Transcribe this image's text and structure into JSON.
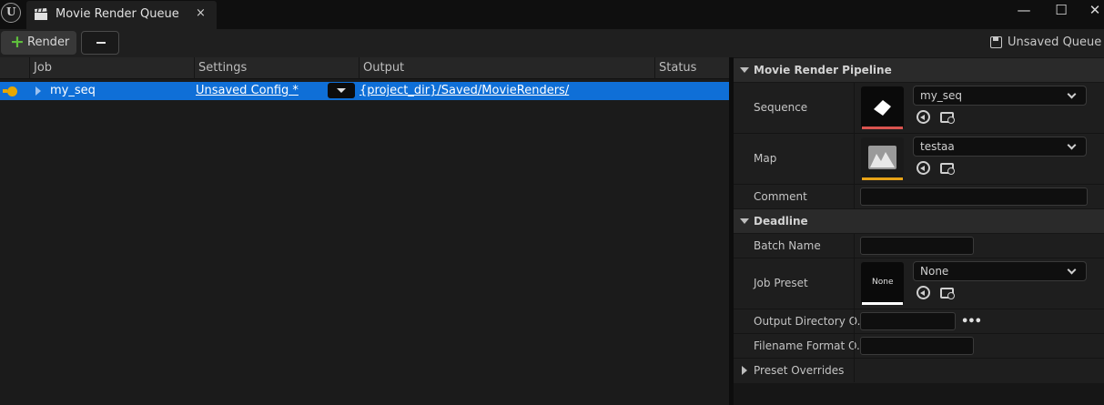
{
  "window": {
    "tab_title": "Movie Render Queue",
    "close_glyph": "×",
    "minimize_glyph": "—",
    "maximize_glyph": "☐",
    "close_window_glyph": "✕",
    "logo_glyph": "U"
  },
  "toolbar": {
    "render_label": "Render",
    "render_plus": "+",
    "save_label": "Unsaved Queue • ▾"
  },
  "queue": {
    "columns": [
      "Job",
      "Settings",
      "Output",
      "Status"
    ],
    "rows": [
      {
        "job": "my_seq",
        "settings": "Unsaved Config *",
        "output": "{project_dir}/Saved/MovieRenders/",
        "status": ""
      }
    ]
  },
  "details": {
    "sections": {
      "pipeline": "Movie Render Pipeline",
      "deadline": "Deadline",
      "preset_overrides": "Preset Overrides"
    },
    "sequence": {
      "label": "Sequence",
      "value": "my_seq"
    },
    "map": {
      "label": "Map",
      "value": "testaa"
    },
    "comment": {
      "label": "Comment",
      "value": ""
    },
    "batch_name": {
      "label": "Batch Name",
      "value": ""
    },
    "job_preset": {
      "label": "Job Preset",
      "value": "None",
      "thumb_text": "None"
    },
    "output_directory": {
      "label": "Output Directory O...",
      "value": "",
      "more": "•••"
    },
    "filename_format": {
      "label": "Filename Format O...",
      "value": ""
    }
  },
  "colors": {
    "selection": "#0f6fd7",
    "status_dot": "#e6a700",
    "sequence_underline": "#d9534f",
    "map_underline": "#e8a317",
    "preset_underline": "#ffffff",
    "add_icon": "#5fbf3d"
  }
}
